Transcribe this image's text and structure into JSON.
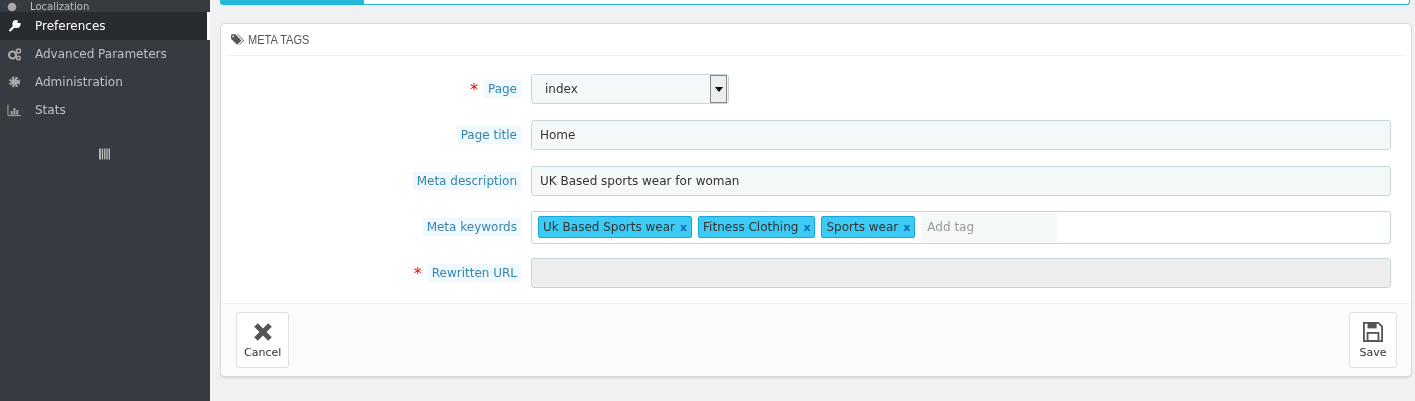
{
  "sidebar": {
    "items": [
      {
        "label": "Localization",
        "selected": false
      },
      {
        "label": "Preferences",
        "selected": true
      },
      {
        "label": "Advanced Parameters",
        "selected": false
      },
      {
        "label": "Administration",
        "selected": false
      },
      {
        "label": "Stats",
        "selected": false
      }
    ]
  },
  "progress": {
    "level": 0.12
  },
  "panel": {
    "title": "META TAGS",
    "fields": [
      {
        "kind": "select",
        "label": "Page",
        "required_mark": "*",
        "value": "index"
      },
      {
        "kind": "text",
        "label": "Page title",
        "value": "Home"
      },
      {
        "kind": "text",
        "label": "Meta description",
        "value": "UK Based sports wear for woman"
      },
      {
        "kind": "tags",
        "label": "Meta keywords",
        "tags": [
          {
            "text": "Uk Based Sports wear",
            "remove": "x"
          },
          {
            "text": "Fitness Clothing",
            "remove": "x"
          },
          {
            "text": "Sports wear",
            "remove": "x"
          }
        ],
        "placeholder": "Add tag"
      },
      {
        "kind": "disabled",
        "label": "Rewritten URL",
        "required_mark": "*"
      }
    ],
    "buttons": [
      {
        "label": "Cancel",
        "kind": "cancel"
      },
      {
        "label": "Save",
        "kind": "save"
      }
    ]
  }
}
